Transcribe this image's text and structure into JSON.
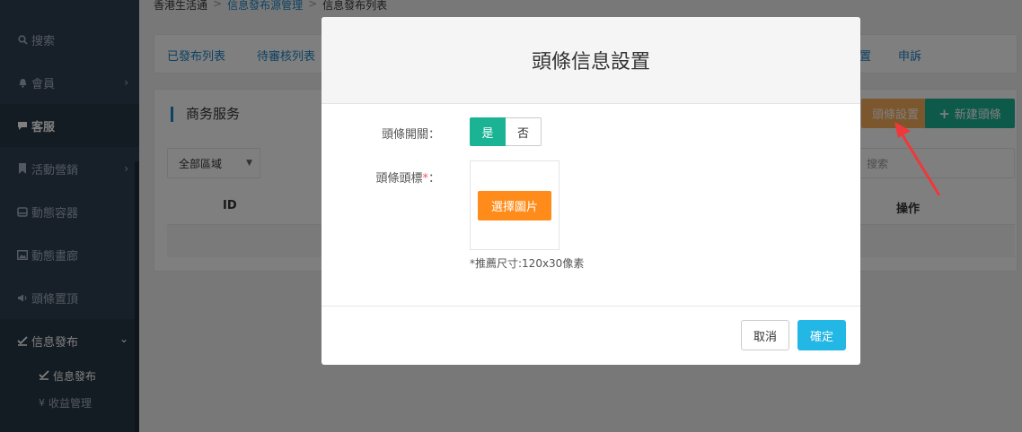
{
  "sidebar": {
    "items": [
      {
        "label": "搜索",
        "icon": "search-icon"
      },
      {
        "label": "會員",
        "icon": "bell-icon"
      },
      {
        "label": "客服",
        "icon": "chat-icon"
      },
      {
        "label": "活動營銷",
        "icon": "bookmark-icon"
      },
      {
        "label": "動態容器",
        "icon": "box-icon"
      },
      {
        "label": "動態畫廊",
        "icon": "image-icon"
      },
      {
        "label": "頭條置頂",
        "icon": "megaphone-icon"
      },
      {
        "label": "信息發布",
        "icon": "check-edit-icon"
      }
    ],
    "sub_items": [
      {
        "label": "信息發布",
        "icon": "check-edit-icon"
      },
      {
        "label": "收益管理",
        "icon": "yen-icon"
      }
    ]
  },
  "breadcrumb": {
    "home": "香港生活通",
    "parent": "信息發布源管理",
    "current": "信息發布列表",
    "separator": ">"
  },
  "tabs": {
    "published": "已發布列表",
    "pending": "待審核列表",
    "settings_partial": "置",
    "complaints": "申訴"
  },
  "panel": {
    "title": "商务服务",
    "headline_btn": "頭條設置",
    "new_btn": "新建頭條",
    "region_select": "全部區域",
    "search_placeholder": "搜索",
    "col_id": "ID",
    "col_action": "操作"
  },
  "modal": {
    "title": "頭條信息設置",
    "switch_label": "頭條開關：",
    "switch_yes": "是",
    "switch_no": "否",
    "icon_label": "頭條頭標",
    "required_mark": "*",
    "icon_label_colon": "：",
    "choose_btn": "選擇圖片",
    "size_hint": "*推薦尺寸:120x30像素",
    "cancel": "取消",
    "confirm": "確定"
  },
  "colors": {
    "sidebar_bg": "#2f4050",
    "primary_green": "#1ab394",
    "orange": "#ff8c1a",
    "blue": "#23b7e5",
    "link_blue": "#1c84c6",
    "annotation_red": "#f0383b"
  }
}
